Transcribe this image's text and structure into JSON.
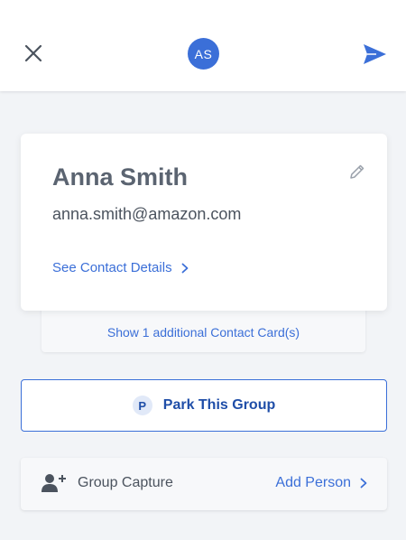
{
  "header": {
    "avatar_initials": "AS",
    "close_icon": "close-icon",
    "send_icon": "send-icon"
  },
  "contact": {
    "name": "Anna Smith",
    "email": "anna.smith@amazon.com",
    "details_link": "See Contact Details",
    "edit_icon": "edit-icon",
    "additional_cards_link": "Show 1 additional Contact Card(s)"
  },
  "park": {
    "badge": "P",
    "label": "Park This Group"
  },
  "group_capture": {
    "label": "Group Capture",
    "action": "Add Person",
    "icon": "add-person-icon"
  },
  "colors": {
    "accent": "#3b6fd8",
    "accent_dark": "#1f4ea8",
    "background": "#f2f4f7",
    "text_gray": "#5b6471"
  }
}
